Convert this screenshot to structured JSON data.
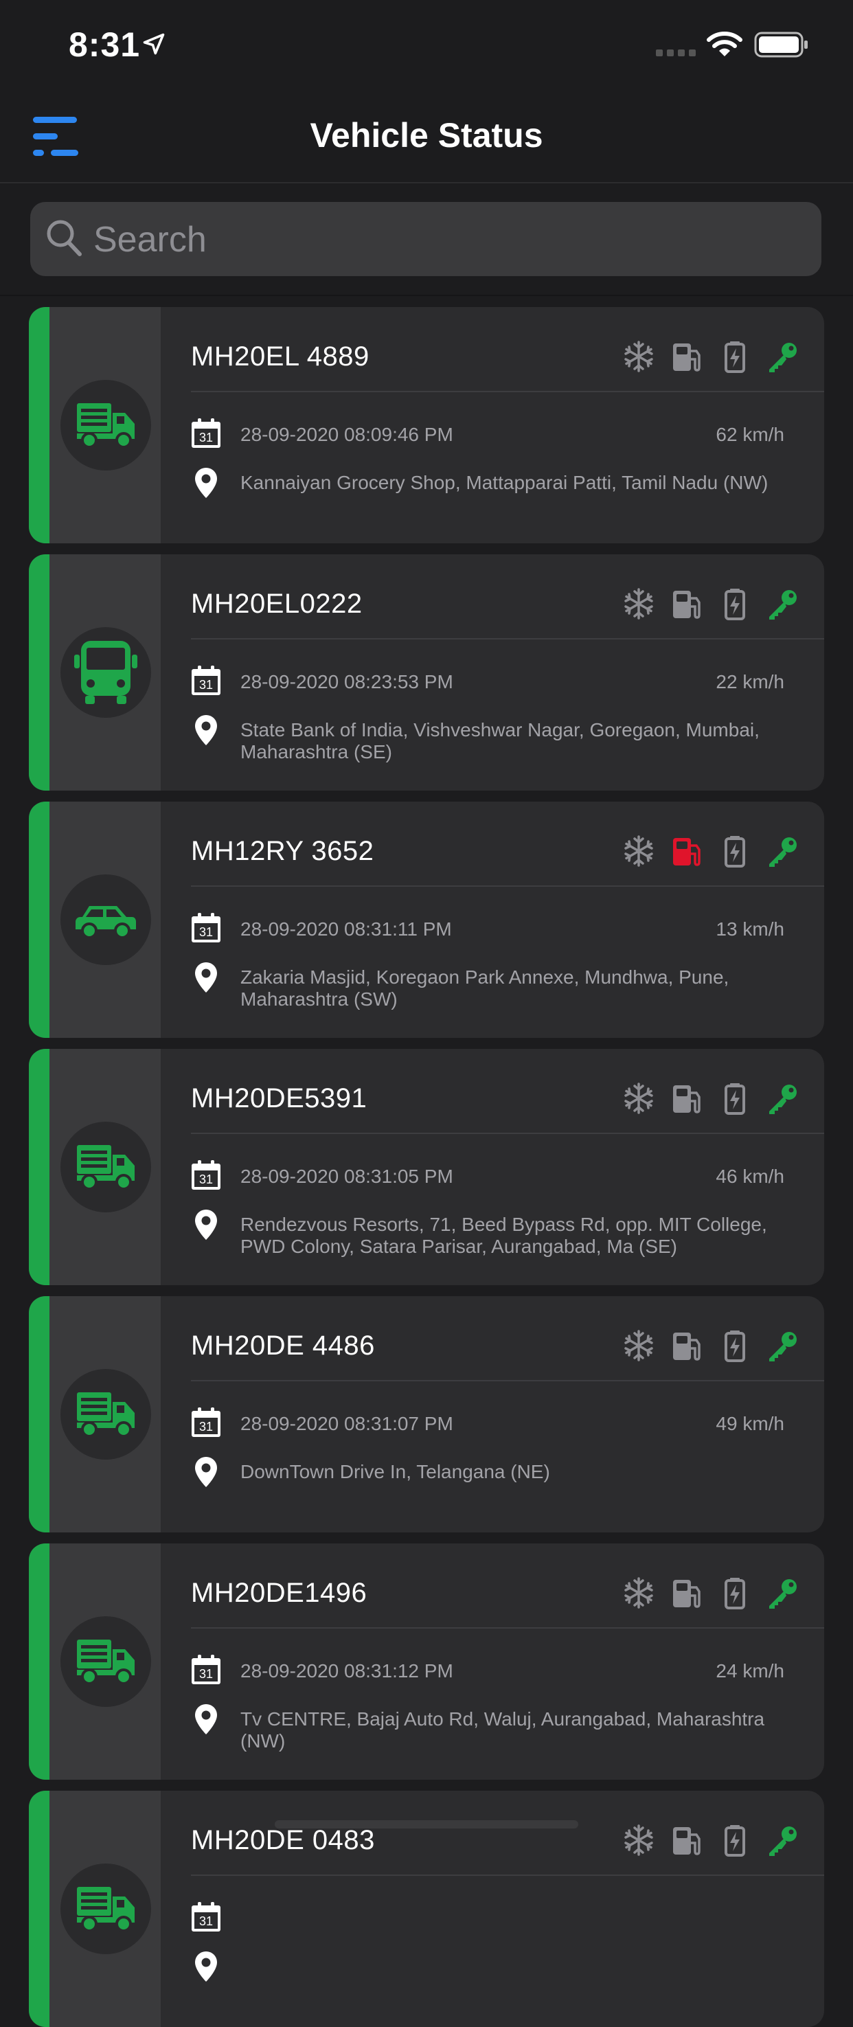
{
  "status_bar": {
    "time": "8:31"
  },
  "nav": {
    "title": "Vehicle Status"
  },
  "search": {
    "placeholder": "Search"
  },
  "colors": {
    "ok": "#1fa64a",
    "alert": "#e0142b",
    "inactive": "#8e8e93"
  },
  "vehicles": [
    {
      "plate": "MH20EL 4889",
      "date": "28-09-2020 08:09:46 PM",
      "speed": "62 km/h",
      "address": "Kannaiyan Grocery Shop, Mattapparai Patti, Tamil Nadu (NW)",
      "type": "truck-icon",
      "fuel_alert": false
    },
    {
      "plate": "MH20EL0222",
      "date": "28-09-2020 08:23:53 PM",
      "speed": "22 km/h",
      "address": "State Bank of India, Vishveshwar Nagar, Goregaon, Mumbai, Maharashtra (SE)",
      "type": "bus-icon",
      "fuel_alert": false
    },
    {
      "plate": "MH12RY 3652",
      "date": "28-09-2020 08:31:11 PM",
      "speed": "13 km/h",
      "address": "Zakaria Masjid, Koregaon Park Annexe, Mundhwa, Pune, Maharashtra (SW)",
      "type": "car-icon",
      "fuel_alert": true
    },
    {
      "plate": "MH20DE5391",
      "date": "28-09-2020 08:31:05 PM",
      "speed": "46 km/h",
      "address": "Rendezvous Resorts, 71, Beed Bypass Rd, opp. MIT College, PWD Colony, Satara Parisar, Aurangabad, Ma (SE)",
      "type": "truck-icon",
      "fuel_alert": false
    },
    {
      "plate": "MH20DE 4486",
      "date": "28-09-2020 08:31:07 PM",
      "speed": "49 km/h",
      "address": "DownTown Drive In, Telangana (NE)",
      "type": "truck-icon",
      "fuel_alert": false
    },
    {
      "plate": "MH20DE1496",
      "date": "28-09-2020 08:31:12 PM",
      "speed": "24 km/h",
      "address": "Tv CENTRE, Bajaj Auto Rd, Waluj, Aurangabad, Maharashtra (NW)",
      "type": "truck-icon",
      "fuel_alert": false
    },
    {
      "plate": "MH20DE 0483",
      "date": "",
      "speed": "",
      "address": "",
      "type": "truck-icon",
      "fuel_alert": false
    }
  ]
}
